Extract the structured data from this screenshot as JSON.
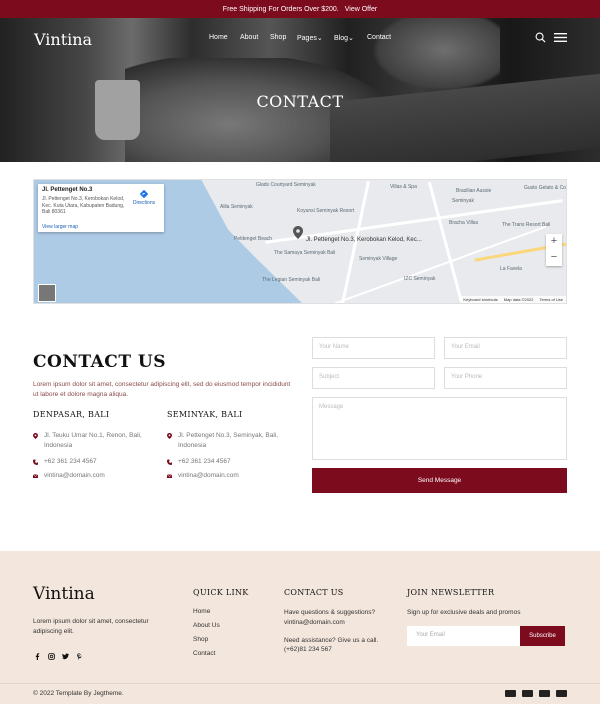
{
  "topbar": {
    "text": "Free Shipping For Orders Over $200.",
    "offer": "View Offer"
  },
  "brand": {
    "logo": "Vintina"
  },
  "nav": {
    "home": "Home",
    "about": "About",
    "shop": "Shop",
    "pages": "Pages",
    "blog": "Blog",
    "contact": "Contact"
  },
  "hero": {
    "title": "CONTACT"
  },
  "map": {
    "info_title": "Jl. Pettenget No.3",
    "info_address": "Jl. Pettenget No.3, Kerobokan Kelod, Kec. Kuta Utara, Kabupaten Badung, Bali 80361",
    "directions": "Directions",
    "larger_map": "View larger map",
    "pin_label": "Jl. Pettenget No.3, Kerobokan Kelod, Kec...",
    "zoom_in": "+",
    "zoom_out": "−",
    "keyboard": "Keyboard shortcuts",
    "data": "Map data ©2022",
    "terms": "Terms of Use",
    "labels": {
      "glads": "Glads Courtyard Seminyak",
      "villas": "Villas & Spa",
      "brazilian": "Brazilian Aussie",
      "gusto": "Gusto Gelato & Co",
      "seminyak": "Seminyak",
      "alila": "Alila Seminyak",
      "koyunsi": "Koyunsi Seminyak Resort",
      "bracha": "Bracha Villas",
      "trans": "The Trans Resort Bali",
      "pettenget_beach": "Petitenget Beach",
      "samaya": "The Samaya Seminyak Bali",
      "village": "Seminyak Village",
      "legian": "The Legian Seminyak Bali",
      "lafavela": "La Favela",
      "izc": "IZC Seminyak"
    }
  },
  "contact": {
    "heading": "CONTACT US",
    "description": "Lorem ipsum dolor sit amet, consectetur adipiscing elit, sed do eiusmod tempor incididunt ut labore et dolore magna aliqua."
  },
  "offices": [
    {
      "title": "DENPASAR, BALI",
      "address": "Jl. Teuku Umar No.1, Renon, Bali, Indonesia",
      "phone": "+62 361 234 4567",
      "email": "vintina@domain.com"
    },
    {
      "title": "SEMINYAK, BALI",
      "address": "Jl. Pettenget No.3, Seminyak, Bali, Indonesia",
      "phone": "+62 361 234 4567",
      "email": "vintina@domain.com"
    }
  ],
  "form": {
    "name": "Your Name",
    "email": "Your Email",
    "subject": "Subject",
    "phone": "Your Phone",
    "message": "Message",
    "send": "Send Message"
  },
  "footer": {
    "logo": "Vintina",
    "about": "Lorem ipsum dolor sit amet, consectetur adipiscing elit.",
    "quick_title": "QUICK LINK",
    "quick_links": [
      "Home",
      "About Us",
      "Shop",
      "Contact"
    ],
    "contact_title": "CONTACT US",
    "contact_q": "Have questions & suggestions?",
    "contact_email": "vintina@domain.com",
    "assist": "Need assistance? Give us a call.",
    "assist_phone": "(+62)81 234 567",
    "news_title": "JOIN NEWSLETTER",
    "news_text": "Sign up for exclusive deals and promos",
    "news_placeholder": "Your Email",
    "subscribe": "Subscribe",
    "copyright": "© 2022 Template By Jegtheme."
  },
  "colors": {
    "accent": "#7d0b1e",
    "footer_bg": "#f3e6dc"
  }
}
